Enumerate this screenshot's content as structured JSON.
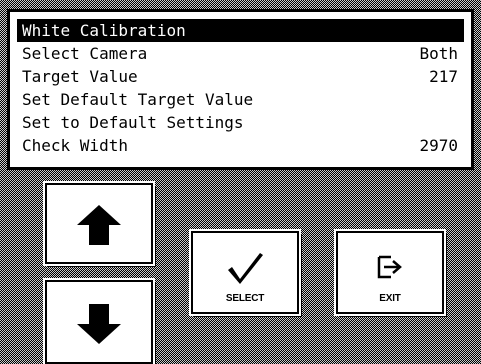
{
  "menu": {
    "items": [
      {
        "label": "White Calibration",
        "value": ""
      },
      {
        "label": "Select Camera",
        "value": "Both"
      },
      {
        "label": "Target Value",
        "value": "217"
      },
      {
        "label": "Set Default Target Value",
        "value": ""
      },
      {
        "label": "Set to Default Settings",
        "value": ""
      },
      {
        "label": "Check Width",
        "value": "2970"
      }
    ],
    "selected_index": 0
  },
  "buttons": {
    "up": {
      "icon": "arrow-up-icon"
    },
    "down": {
      "icon": "arrow-down-icon"
    },
    "select": {
      "label": "SELECT",
      "icon": "checkmark-icon"
    },
    "exit": {
      "label": "EXIT",
      "icon": "exit-icon"
    }
  }
}
